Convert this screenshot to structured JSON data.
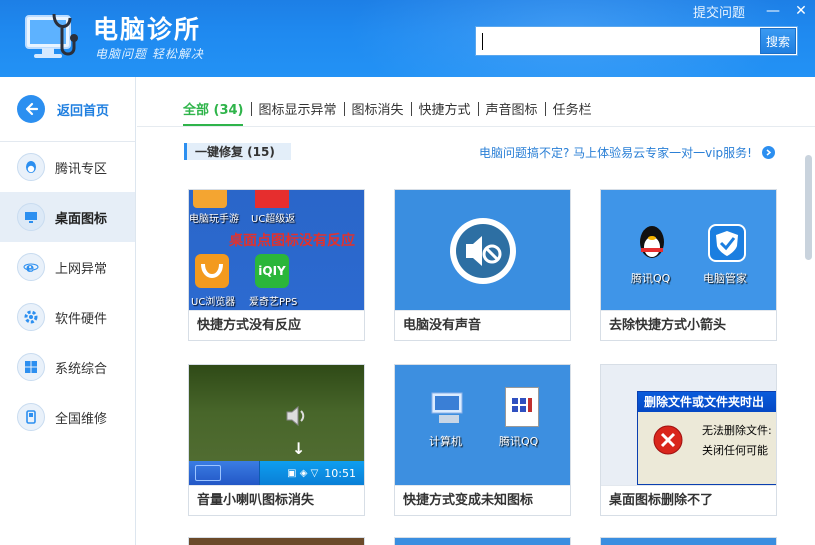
{
  "app": {
    "title": "电脑诊所",
    "slogan": "电脑问题 轻松解决",
    "feedback_link": "提交问题",
    "minimize": "—",
    "close": "✕"
  },
  "search": {
    "value": "",
    "button": "搜索"
  },
  "sidebar": {
    "back_label": "返回首页",
    "items": [
      {
        "label": "腾讯专区",
        "icon": "qq-penguin-icon",
        "active": false
      },
      {
        "label": "桌面图标",
        "icon": "monitor-icon",
        "active": true
      },
      {
        "label": "上网异常",
        "icon": "ie-browser-icon",
        "active": false
      },
      {
        "label": "软件硬件",
        "icon": "gear-icon",
        "active": false
      },
      {
        "label": "系统综合",
        "icon": "windows-logo-icon",
        "active": false
      },
      {
        "label": "全国维修",
        "icon": "phone-icon",
        "active": false
      }
    ]
  },
  "tabs": [
    {
      "label": "全部 (34)",
      "active": true
    },
    {
      "label": "图标显示异常",
      "active": false
    },
    {
      "label": "图标消失",
      "active": false
    },
    {
      "label": "快捷方式",
      "active": false
    },
    {
      "label": "声音图标",
      "active": false
    },
    {
      "label": "任务栏",
      "active": false
    }
  ],
  "section": {
    "title": "一键修复 (15)",
    "promo": "电脑问题搞不定? 马上体验易云专家一对一vip服务!"
  },
  "cards": [
    {
      "caption": "快捷方式没有反应",
      "thumb": {
        "icons": [
          "电脑玩手游",
          "UC超级返",
          "UC浏览器",
          "爱奇艺PPS"
        ],
        "overlay": "桌面点图标没有反应"
      }
    },
    {
      "caption": "电脑没有声音",
      "thumb": {}
    },
    {
      "caption": "去除快捷方式小箭头",
      "thumb": {
        "icons": [
          "腾讯QQ",
          "电脑管家"
        ]
      }
    },
    {
      "caption": "音量小喇叭图标消失",
      "thumb": {
        "clock": "10:51"
      }
    },
    {
      "caption": "快捷方式变成未知图标",
      "thumb": {
        "icons": [
          "计算机",
          "腾讯QQ"
        ]
      }
    },
    {
      "caption": "桌面图标删除不了",
      "thumb": {
        "dialog_title": "删除文件或文件夹时出",
        "line1": "无法删除文件:",
        "line2": "关闭任何可能"
      }
    }
  ],
  "colors": {
    "header_blue": "#1f8af0",
    "tab_active_green": "#2fb44a",
    "link_blue": "#2a7fd6"
  }
}
